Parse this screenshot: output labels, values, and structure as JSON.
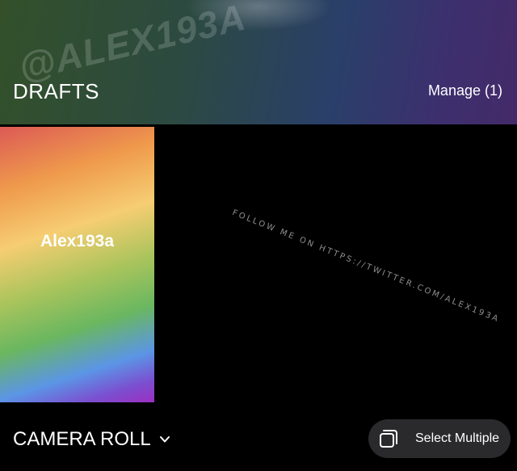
{
  "header": {
    "watermark": "@ALEX193A",
    "title": "DRAFTS",
    "manage_label": "Manage (1)"
  },
  "drafts": [
    {
      "label": "Alex193a"
    }
  ],
  "watermark_follow": "FOLLOW ME ON HTTPS://TWITTER.COM/ALEX193A",
  "footer": {
    "camera_roll_label": "CAMERA ROLL",
    "select_multiple_label": "Select Multiple"
  },
  "icons": {
    "camera_roll_chevron": "chevron-down-icon",
    "select_multiple": "select-multiple-icon"
  }
}
